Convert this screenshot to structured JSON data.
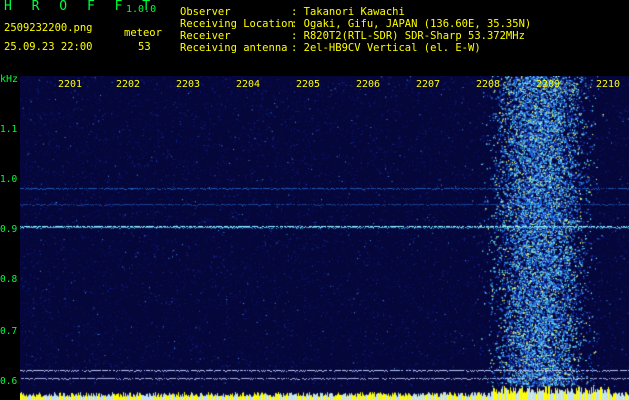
{
  "header": {
    "app_title": "H R O F F T",
    "version": "1.0.0",
    "filename": "2509232200.png",
    "datetime": "25.09.23 22:00",
    "mode_label": "meteor",
    "count": "53",
    "info": [
      {
        "label": "Observer",
        "value": ": Takanori Kawachi"
      },
      {
        "label": "Receiving Location",
        "value": ": Ogaki, Gifu, JAPAN (136.60E, 35.35N)"
      },
      {
        "label": "Receiver",
        "value": ": R820T2(RTL-SDR) SDR-Sharp 53.372MHz"
      },
      {
        "label": "Receiving antenna",
        "value": ": 2el-HB9CV Vertical (el. E-W)"
      }
    ]
  },
  "spectrogram": {
    "y_unit": "kHz",
    "y_ticks": [
      "1.1",
      "1.0",
      "0.9",
      "0.8",
      "0.7",
      "0.6"
    ],
    "x_ticks": [
      "2201",
      "2202",
      "2203",
      "2204",
      "2205",
      "2206",
      "2207",
      "2208",
      "2209",
      "2210"
    ],
    "colors": {
      "background": "#05063a",
      "signal": "#5fe0ff",
      "noise_bar": "#ffff00",
      "label": "#ffff00",
      "axis": "#00ff3c"
    }
  }
}
